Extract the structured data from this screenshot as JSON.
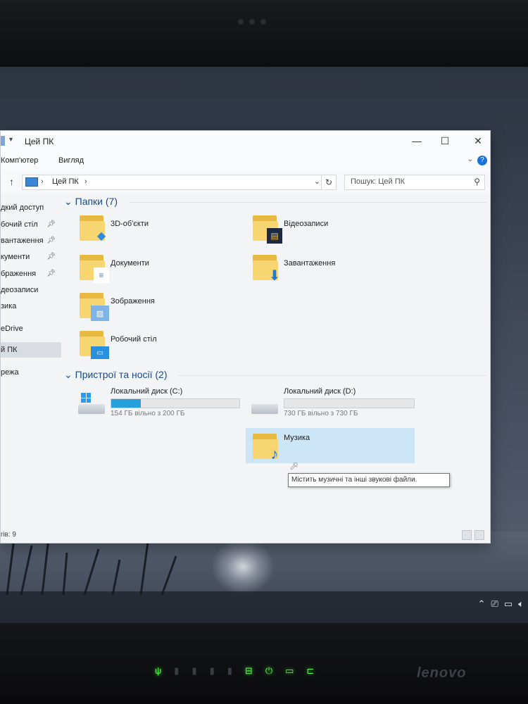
{
  "window": {
    "title": "Цей ПК",
    "controls": {
      "minimize": "—",
      "maximize": "☐",
      "close": "✕"
    }
  },
  "menu": {
    "items": [
      "Комп'ютер",
      "Вигляд"
    ],
    "help": "?"
  },
  "address": {
    "path": "Цей ПК",
    "search_placeholder": "Пошук: Цей ПК"
  },
  "sidebar": {
    "items": [
      {
        "label": "дкий доступ",
        "pinned": false
      },
      {
        "label": "бочий стіл",
        "pinned": true
      },
      {
        "label": "вантаження",
        "pinned": true
      },
      {
        "label": "кументи",
        "pinned": true
      },
      {
        "label": "браження",
        "pinned": true
      },
      {
        "label": "деозаписи",
        "pinned": false
      },
      {
        "label": "зика",
        "pinned": false
      },
      {
        "label": "eDrive",
        "pinned": false
      },
      {
        "label": "й ПК",
        "pinned": false,
        "selected": true
      },
      {
        "label": "режа",
        "pinned": false
      }
    ]
  },
  "folders": {
    "header": "Папки (7)",
    "items": [
      {
        "label": "3D-об'єкти",
        "icon": "3d-objects-icon"
      },
      {
        "label": "Відеозаписи",
        "icon": "video-icon"
      },
      {
        "label": "Документи",
        "icon": "document-icon"
      },
      {
        "label": "Завантаження",
        "icon": "download-icon"
      },
      {
        "label": "Зображення",
        "icon": "picture-icon"
      },
      {
        "label": "Музика",
        "icon": "music-icon",
        "selected": true
      },
      {
        "label": "Робочий стіл",
        "icon": "desktop-icon"
      }
    ],
    "tooltip": "Містить музичні та інші звукові файли."
  },
  "devices": {
    "header": "Пристрої та носії (2)",
    "items": [
      {
        "label": "Локальний диск (C:)",
        "free": "154 ГБ вільно з 200 ГБ",
        "used_fraction": 0.23,
        "bar_color": "#26a0da"
      },
      {
        "label": "Локальний диск (D:)",
        "free": "730 ГБ вільно з 730 ГБ",
        "used_fraction": 0.0,
        "bar_color": "#26a0da"
      }
    ]
  },
  "status": {
    "text": "rів: 9"
  },
  "laptop": {
    "brand": "lenovo"
  }
}
